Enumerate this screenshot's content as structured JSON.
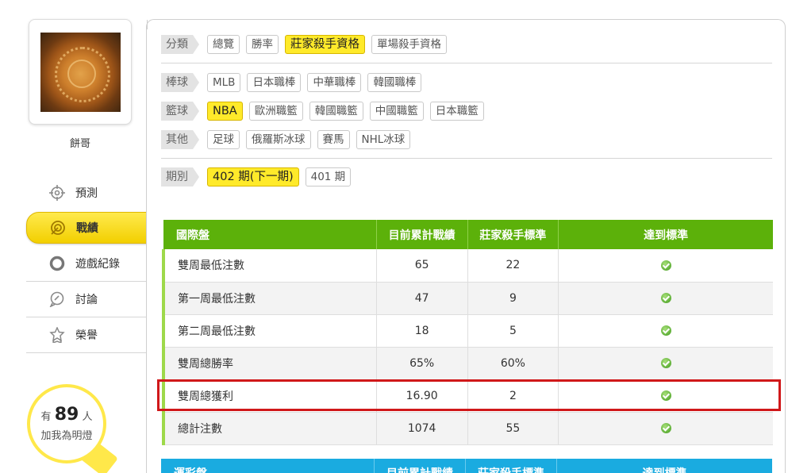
{
  "user": {
    "name": "餅哥"
  },
  "nav": [
    {
      "label": "預測",
      "icon": "crosshair-icon"
    },
    {
      "label": "戰績",
      "icon": "target-icon",
      "active": true
    },
    {
      "label": "遊戲紀錄",
      "icon": "circle-icon"
    },
    {
      "label": "討論",
      "icon": "chat-icon"
    },
    {
      "label": "榮譽",
      "icon": "medal-icon"
    }
  ],
  "lamp": {
    "prefix": "有",
    "count": "89",
    "suffix": "人",
    "subtitle": "加我為明燈"
  },
  "filters": {
    "category": {
      "label": "分類",
      "options": [
        "總覽",
        "勝率",
        "莊家殺手資格",
        "單場殺手資格"
      ],
      "selected": "莊家殺手資格"
    },
    "baseball": {
      "label": "棒球",
      "options": [
        "MLB",
        "日本職棒",
        "中華職棒",
        "韓國職棒"
      ]
    },
    "basketball": {
      "label": "籃球",
      "options": [
        "NBA",
        "歐洲職籃",
        "韓國職籃",
        "中國職籃",
        "日本職籃"
      ],
      "selected": "NBA"
    },
    "other": {
      "label": "其他",
      "options": [
        "足球",
        "俄羅斯冰球",
        "賽馬",
        "NHL冰球"
      ]
    },
    "period": {
      "label": "期別",
      "options": [
        "402 期(下一期)",
        "401 期"
      ],
      "selected": "402 期(下一期)"
    }
  },
  "table": {
    "headers": [
      "國際盤",
      "目前累計戰績",
      "莊家殺手標準",
      "達到標準"
    ],
    "rows": [
      {
        "label": "雙周最低注數",
        "current": "65",
        "standard": "22",
        "met": true
      },
      {
        "label": "第一周最低注數",
        "current": "47",
        "standard": "9",
        "met": true
      },
      {
        "label": "第二周最低注數",
        "current": "18",
        "standard": "5",
        "met": true
      },
      {
        "label": "雙周總勝率",
        "current": "65%",
        "standard": "60%",
        "met": true
      },
      {
        "label": "雙周總獲利",
        "current": "16.90",
        "standard": "2",
        "met": true
      },
      {
        "label": "總計注數",
        "current": "1074",
        "standard": "55",
        "met": true
      }
    ]
  },
  "table2": {
    "headers": [
      "運彩盤",
      "目前累計戰績",
      "莊家殺手標準",
      "達到標準"
    ]
  },
  "colors": {
    "accent_yellow": "#ffea2a",
    "header_green": "#5cb10a",
    "header_blue": "#1aabe0",
    "highlight_red": "#d0181a"
  }
}
